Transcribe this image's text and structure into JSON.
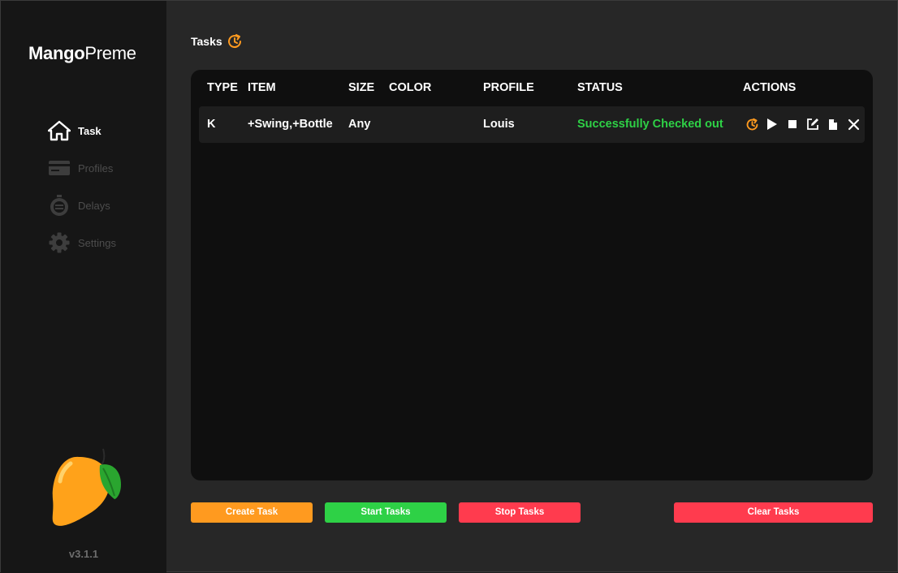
{
  "app": {
    "brand_bold": "Mango",
    "brand_light": "Preme",
    "version": "v3.1.1"
  },
  "sidebar": {
    "items": [
      {
        "label": "Task",
        "icon": "home-icon",
        "active": true
      },
      {
        "label": "Profiles",
        "icon": "credit-card-icon",
        "active": false
      },
      {
        "label": "Delays",
        "icon": "stopwatch-icon",
        "active": false
      },
      {
        "label": "Settings",
        "icon": "gear-icon",
        "active": false
      }
    ]
  },
  "main": {
    "title": "Tasks",
    "title_icon": "clock-refresh-icon",
    "table": {
      "columns": [
        "TYPE",
        "ITEM",
        "SIZE",
        "COLOR",
        "PROFILE",
        "STATUS",
        "ACTIONS"
      ],
      "rows": [
        {
          "type": "K",
          "item": "+Swing,+Bottle",
          "size": "Any",
          "color": "",
          "profile": "Louis",
          "status": "Successfully Checked out",
          "actions": [
            "clock-refresh-icon",
            "play-icon",
            "stop-icon",
            "edit-icon",
            "file-icon",
            "close-icon"
          ]
        }
      ]
    }
  },
  "buttons": {
    "create": "Create Task",
    "start": "Start Tasks",
    "stop": "Stop Tasks",
    "clear": "Clear Tasks"
  },
  "colors": {
    "accent_orange": "#ff9a1f",
    "success_green": "#2ed146",
    "danger_red": "#ff3b4e",
    "panel": "#0f0f0f",
    "sidebar": "#161616"
  }
}
